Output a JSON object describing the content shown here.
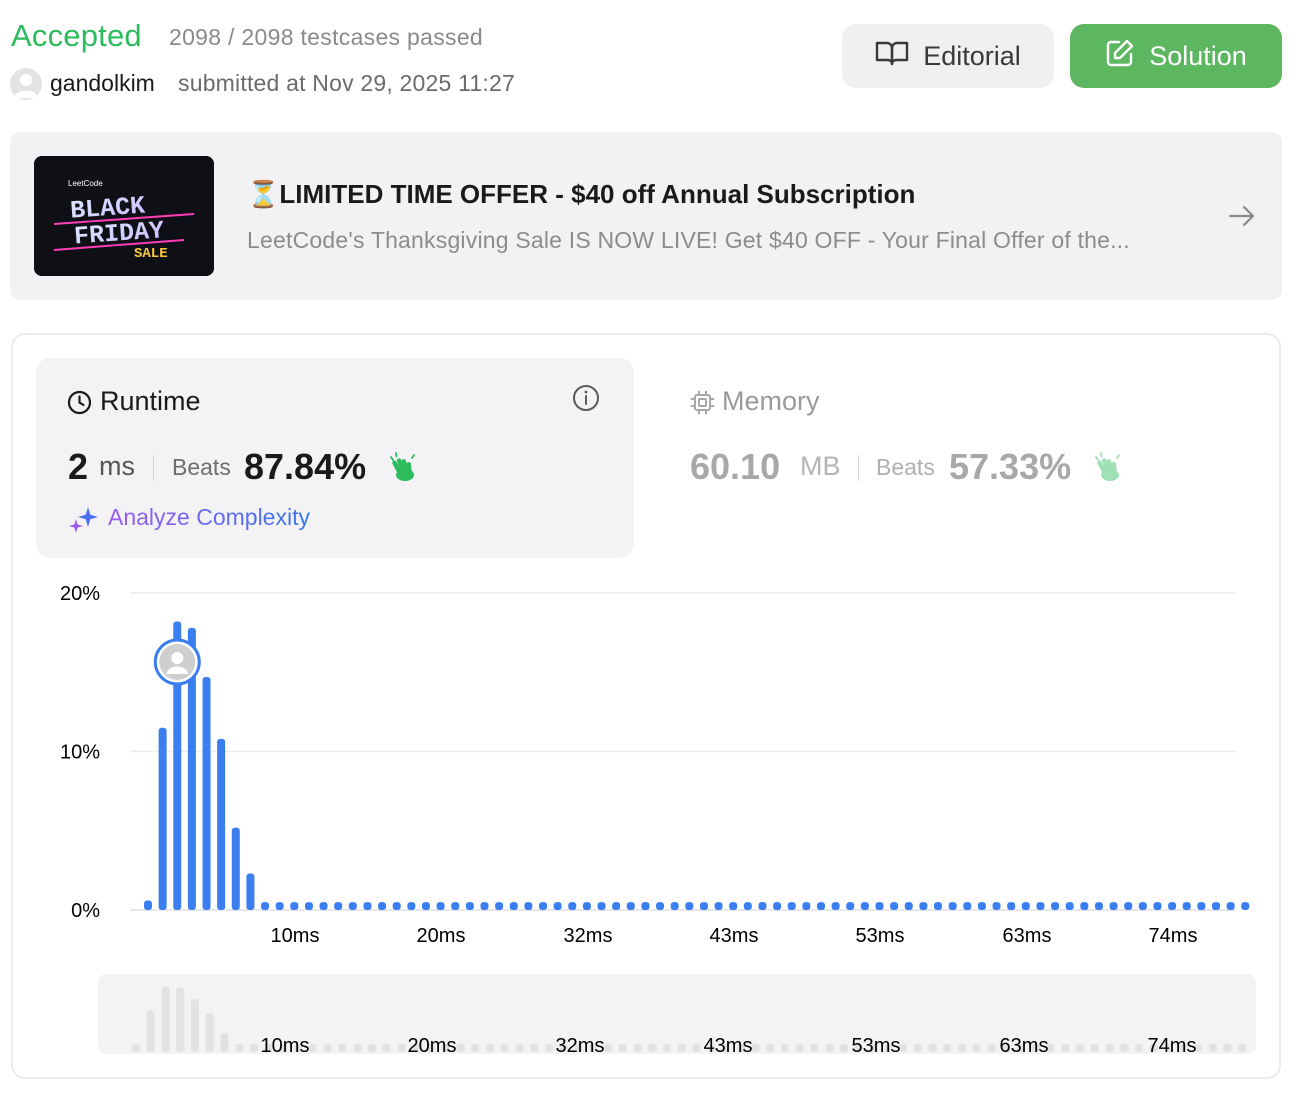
{
  "header": {
    "status": "Accepted",
    "testcases": "2098 / 2098 testcases passed",
    "username": "gandolkim",
    "submitted": "submitted at Nov 29, 2025 11:27",
    "editorial_label": "Editorial",
    "solution_label": "Solution"
  },
  "promo": {
    "image_brand": "LeetCode",
    "image_line1": "BLACK",
    "image_line2": "FRIDAY",
    "image_line3": "SALE",
    "title": "⏳LIMITED TIME OFFER - $40 off Annual Subscription",
    "subtitle": "LeetCode's Thanksgiving Sale IS NOW LIVE! Get $40 OFF - Your Final Offer of the..."
  },
  "runtime": {
    "label": "Runtime",
    "value": "2",
    "unit": "ms",
    "beats_label": "Beats",
    "beats_value": "87.84%",
    "analyze_label": "Analyze Complexity"
  },
  "memory": {
    "label": "Memory",
    "value": "60.10",
    "unit": "MB",
    "beats_label": "Beats",
    "beats_value": "57.33%"
  },
  "colors": {
    "accepted": "#2cbb5d",
    "solution_button": "#5db760",
    "bar": "#3b7ef0",
    "bar_overview": "#e2e2e2"
  },
  "icons": {
    "editorial": "book-open-icon",
    "solution": "pencil-square-icon",
    "runtime": "clock-icon",
    "memory": "chip-icon",
    "info": "info-icon",
    "analyze": "sparkles-icon",
    "beats": "clapping-hands-icon",
    "promo_arrow": "arrow-right-icon"
  },
  "chart_data": {
    "type": "bar",
    "ylim": [
      0,
      20
    ],
    "yticks": [
      "20%",
      "10%",
      "0%"
    ],
    "xticks": [
      "10ms",
      "20ms",
      "32ms",
      "43ms",
      "53ms",
      "63ms",
      "74ms"
    ],
    "values": [
      0.6,
      11.5,
      18.2,
      17.8,
      14.7,
      10.8,
      5.2,
      2.3,
      0.5,
      0.5,
      0.5,
      0.5,
      0.5,
      0.5,
      0.5,
      0.5,
      0.5,
      0.5,
      0.5,
      0.5,
      0.5,
      0.5,
      0.5,
      0.5,
      0.5,
      0.5,
      0.5,
      0.5,
      0.5,
      0.5,
      0.5,
      0.5,
      0.5,
      0.5,
      0.5,
      0.5,
      0.5,
      0.5,
      0.5,
      0.5,
      0.5,
      0.5,
      0.5,
      0.5,
      0.5,
      0.5,
      0.5,
      0.5,
      0.5,
      0.5,
      0.5,
      0.5,
      0.5,
      0.5,
      0.5,
      0.5,
      0.5,
      0.5,
      0.5,
      0.5,
      0.5,
      0.5,
      0.5,
      0.5,
      0.5,
      0.5,
      0.5,
      0.5,
      0.5,
      0.5,
      0.5,
      0.5,
      0.5,
      0.5,
      0.5,
      0.5
    ],
    "user_bar_index": 2
  }
}
